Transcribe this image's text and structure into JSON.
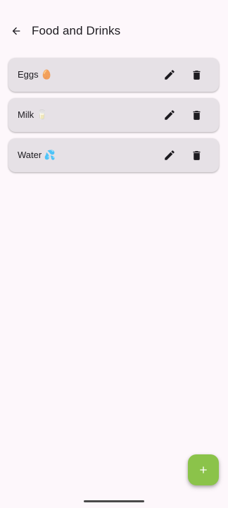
{
  "header": {
    "title": "Food and Drinks"
  },
  "items": [
    {
      "label": "Eggs 🥚"
    },
    {
      "label": "Milk 🥛"
    },
    {
      "label": "Water 💦"
    }
  ],
  "icons": {
    "back": "arrow-back-icon",
    "edit": "pencil-icon",
    "delete": "trash-icon",
    "add": "plus-icon"
  },
  "colors": {
    "background": "#fdf7fb",
    "card": "#e6e1e6",
    "fab": "#8bc34a",
    "icon": "#1d1b20"
  }
}
